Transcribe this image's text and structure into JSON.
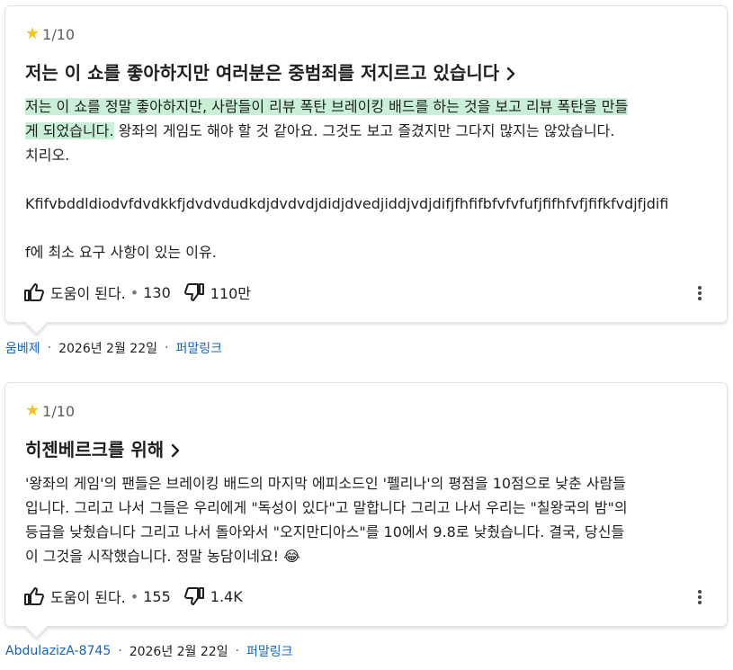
{
  "reviews": [
    {
      "rating": "1/10",
      "title": "저는 이 쇼를 좋아하지만 여러분은 중범죄를 저지르고 있습니다",
      "body_highlight_1": "저는 이 쇼를 정말 좋아하지만, 사람들이 리뷰 폭탄 브레이킹 배드를 하는 것을 보고 리뷰 폭탄을 만들",
      "body_highlight_2": "게 되었습니다.",
      "body_rest_2": " 왕좌의 게임도 해야 할 것 같아요. 그것도 보고 즐겼지만 그다지 많지는 않았습니다.",
      "body_line_3": "치리오.",
      "body_line_4": "Kfifvbddldiodvfdvdkkfjdvdvdudkdjdvdvdjdidjdvedjiddjvdjdifjfhfifbfvfvfufjfifhfvfjfifkfvdjfjdifi",
      "body_line_5": "f에 최소 요구 사항이 있는 이유.",
      "helpful_label": "도움이 된다.",
      "helpful_count": "130",
      "unhelpful_count": "110만",
      "author": "움베제",
      "date": "2026년 2월 22일",
      "permalink": "퍼말링크"
    },
    {
      "rating": "1/10",
      "title": "히젠베르크를 위해",
      "body_line_1": "'왕좌의 게임'의 팬들은 브레이킹 배드의 마지막 에피소드인 '펠리나'의 평점을 10점으로 낮춘 사람들",
      "body_line_2": "입니다. 그리고 나서 그들은 우리에게 \"독성이 있다\"고 말합니다 그리고 나서 우리는 \"칠왕국의 밤\"의",
      "body_line_3": "등급을 낮췄습니다 그리고 나서 돌아와서 \"오지만디아스\"를 10에서 9.8로 낮췄습니다. 결국, 당신들",
      "body_line_4": "이 그것을 시작했습니다. 정말 농담이네요! 😂",
      "helpful_label": "도움이 된다.",
      "helpful_count": "155",
      "unhelpful_count": "1.4K",
      "author": "AbdulazizA-8745",
      "date": "2026년 2월 22일",
      "permalink": "퍼말링크"
    }
  ],
  "icons": {
    "star": "star-icon",
    "chevron": "chevron-right-icon",
    "thumb_up": "thumb-up-icon",
    "thumb_down": "thumb-down-icon",
    "more": "more-vert-icon"
  },
  "colors": {
    "star": "#f5c518",
    "highlight": "#c9f0d6",
    "link": "#1565c0"
  }
}
